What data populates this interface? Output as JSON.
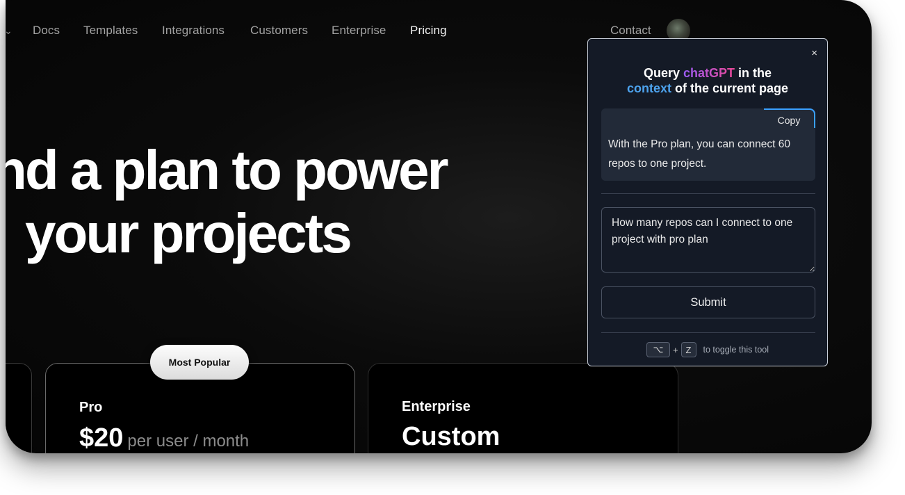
{
  "nav": {
    "items": [
      "Docs",
      "Templates",
      "Integrations",
      "Customers",
      "Enterprise",
      "Pricing"
    ],
    "active": "Pricing",
    "contact": "Contact"
  },
  "hero": {
    "line1": "nd a plan to power",
    "line2": "your projects"
  },
  "cards": {
    "badge": "Most Popular",
    "pro": {
      "name": "Pro",
      "price": "$20",
      "unit": "per user / month"
    },
    "enterprise": {
      "name": "Enterprise",
      "price": "Custom"
    }
  },
  "popup": {
    "close": "×",
    "title": {
      "query": "Query",
      "chatgpt": "chatGPT",
      "in_the": "in the",
      "context": "context",
      "rest": "of the current page"
    },
    "copy_label": "Copy",
    "answer": "With the Pro plan, you can connect 60 repos to one project.",
    "question_value": "How many repos can I connect to one project with pro plan",
    "submit_label": "Submit",
    "shortcut": {
      "key1": "⌥",
      "plus": "+",
      "key2": "Z",
      "hint": "to toggle this tool"
    }
  }
}
